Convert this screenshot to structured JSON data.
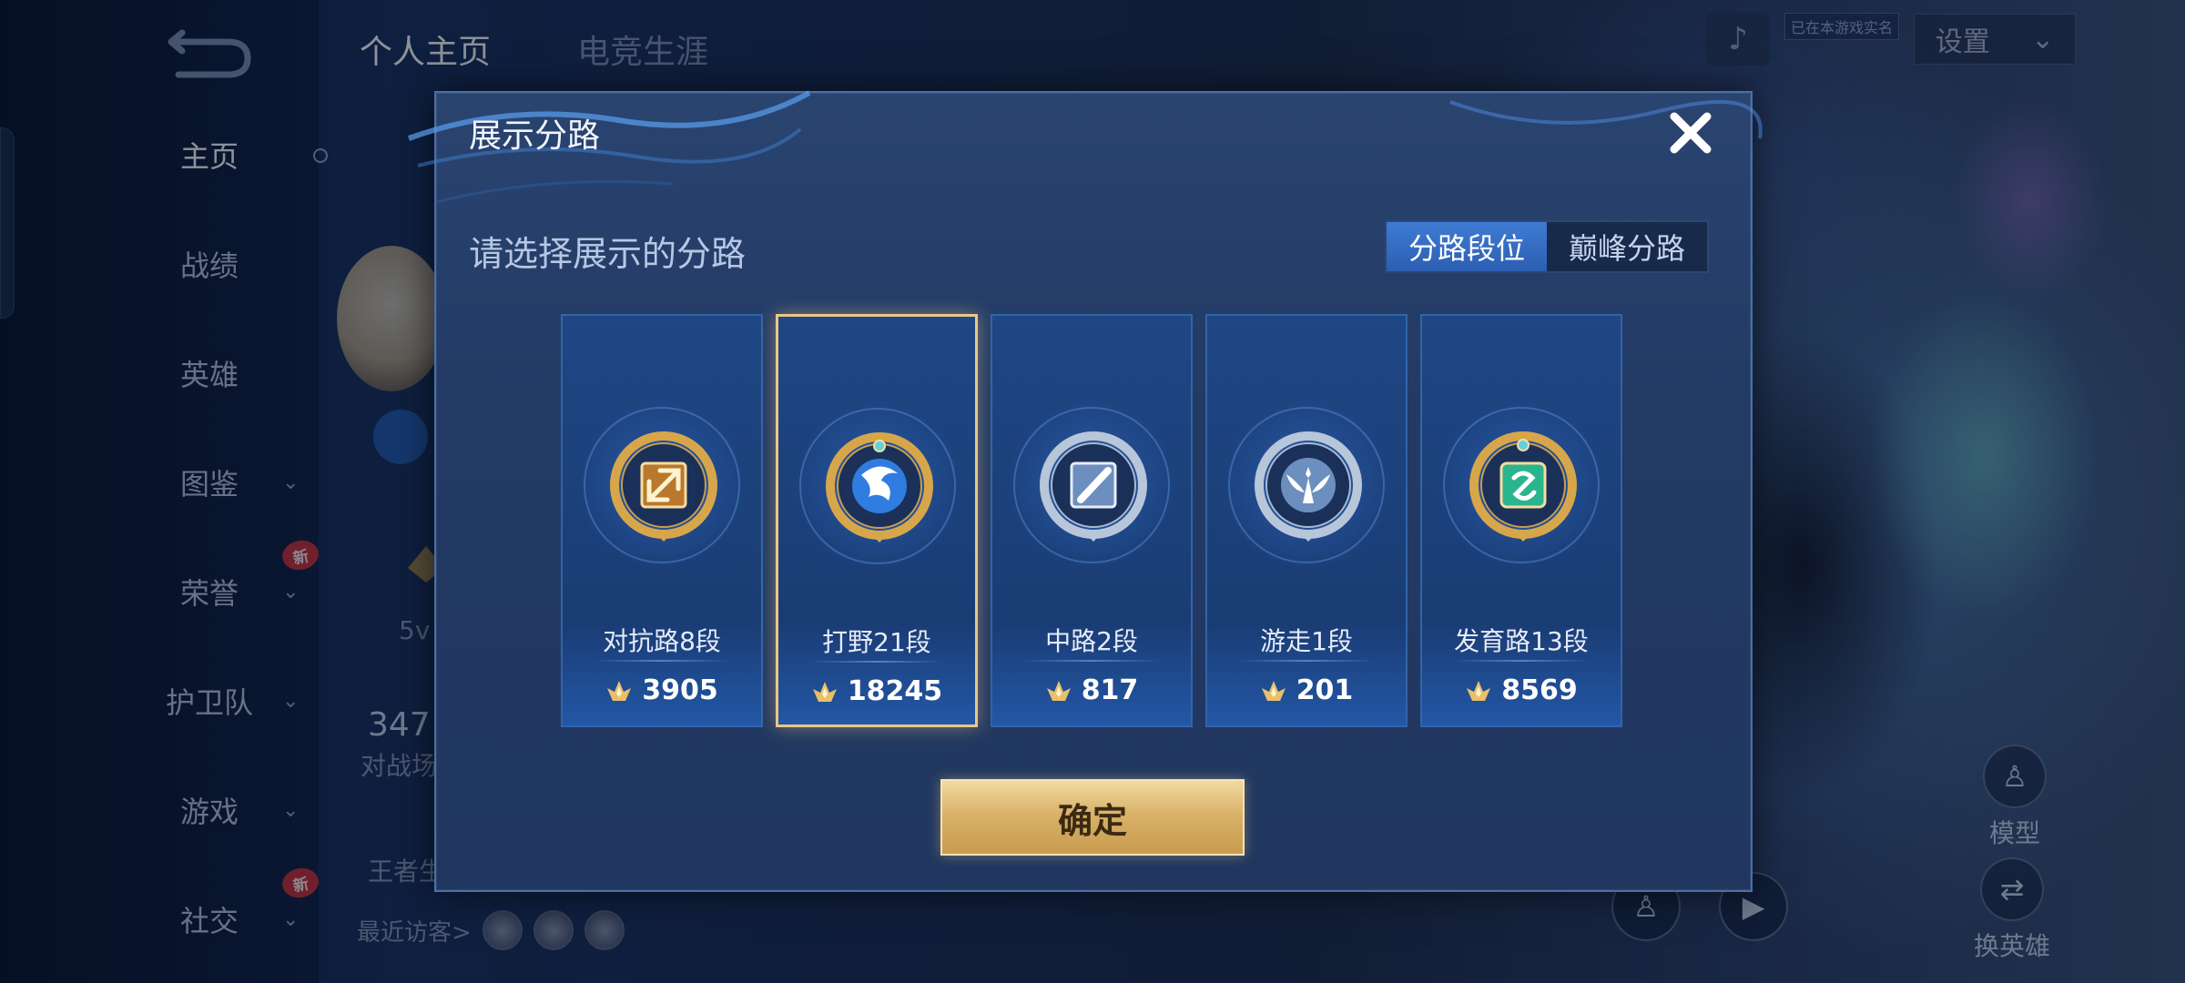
{
  "background": {
    "tabs": [
      {
        "label": "个人主页",
        "active": true
      },
      {
        "label": "电竞生涯",
        "active": false
      }
    ],
    "side_nav": [
      {
        "label": "主页",
        "active": true,
        "has_chevron": false,
        "new_badge": false
      },
      {
        "label": "战绩",
        "active": false,
        "has_chevron": false,
        "new_badge": false
      },
      {
        "label": "英雄",
        "active": false,
        "has_chevron": false,
        "new_badge": false
      },
      {
        "label": "图鉴",
        "active": false,
        "has_chevron": true,
        "new_badge": false
      },
      {
        "label": "荣誉",
        "active": false,
        "has_chevron": true,
        "new_badge": true
      },
      {
        "label": "护卫队",
        "active": false,
        "has_chevron": true,
        "new_badge": false
      },
      {
        "label": "游戏",
        "active": false,
        "has_chevron": true,
        "new_badge": false
      },
      {
        "label": "社交",
        "active": false,
        "has_chevron": true,
        "new_badge": true
      }
    ],
    "new_badge_label": "新",
    "peek_texts": {
      "vs": "5v",
      "count": "347",
      "count_label": "对战场",
      "king_label": "王者生"
    },
    "recent_visitors_label": "最近访客>",
    "settings_label": "设置",
    "flag_label": "已在本游戏实名",
    "right_controls": {
      "model_label": "模型",
      "change_hero_label": "换英雄"
    }
  },
  "modal": {
    "title": "展示分路",
    "subtitle": "请选择展示的分路",
    "segments": [
      {
        "label": "分路段位",
        "active": true
      },
      {
        "label": "巅峰分路",
        "active": false
      }
    ],
    "lanes": [
      {
        "label": "对抗路8段",
        "score": "3905",
        "emblem": "clash-lane-icon",
        "selected": false,
        "tier_color": "#d8a64a",
        "inner_color": "#b9782c"
      },
      {
        "label": "打野21段",
        "score": "18245",
        "emblem": "jungle-dragon-icon",
        "selected": true,
        "tier_color": "#d8a64a",
        "inner_color": "#2f7de0"
      },
      {
        "label": "中路2段",
        "score": "817",
        "emblem": "mid-lane-icon",
        "selected": false,
        "tier_color": "#b8c6da",
        "inner_color": "#6d8fbf"
      },
      {
        "label": "游走1段",
        "score": "201",
        "emblem": "roam-wings-icon",
        "selected": false,
        "tier_color": "#b8c6da",
        "inner_color": "#6d8fbf"
      },
      {
        "label": "发育路13段",
        "score": "8569",
        "emblem": "farm-lane-icon",
        "selected": false,
        "tier_color": "#d8a64a",
        "inner_color": "#2bb58f"
      }
    ],
    "confirm_label": "确定"
  }
}
